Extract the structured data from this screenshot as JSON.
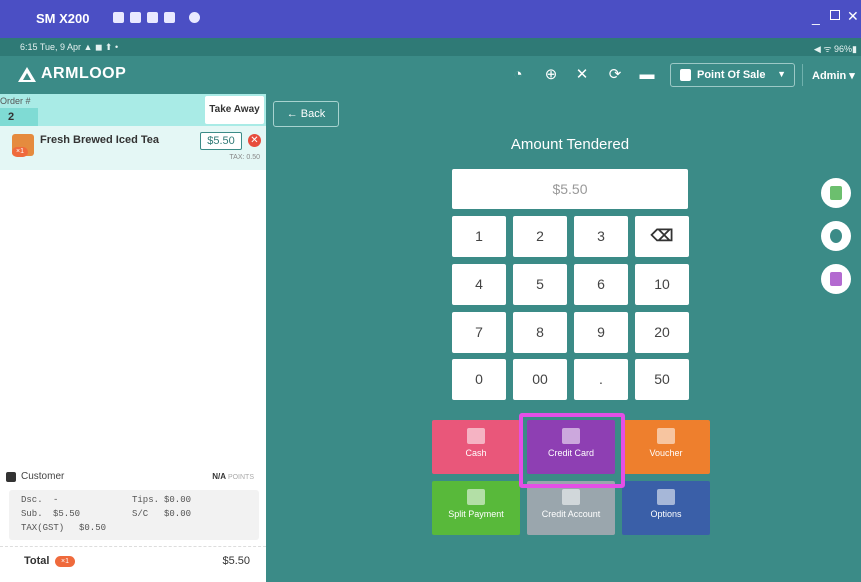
{
  "emulator": {
    "title": "SM X200"
  },
  "status_bar": {
    "time_date": "6:15  Tue, 9 Apr  ▲ ◼ ⬆ •",
    "right": "◀ ᯤ 96%▮"
  },
  "app_bar": {
    "brand": "ARMLOOP",
    "mode": "Point Of Sale",
    "user": "Admin",
    "icons": [
      "speedometer-icon",
      "globe-icon",
      "utensils-icon",
      "sync-icon",
      "printer-icon"
    ]
  },
  "order": {
    "order_label": "Order #",
    "order_number": "2",
    "service_type": "Take Away",
    "items": [
      {
        "name": "Fresh Brewed Iced Tea",
        "qty_badge": "×1",
        "price": "$5.50",
        "tax": "TAX: 0.50"
      }
    ],
    "customer_label": "Customer",
    "customer_value": "N/A",
    "points_label": "POINTS",
    "totals": {
      "dsc_label": "Dsc.",
      "dsc_value": "-",
      "tips_label": "Tips.",
      "tips_value": "$0.00",
      "sub_label": "Sub.",
      "sub_value": "$5.50",
      "sc_label": "S/C",
      "sc_value": "$0.00",
      "tax_label": "TAX(GST)",
      "tax_value": "$0.50"
    },
    "total_label": "Total",
    "total_badge": "×1",
    "total_value": "$5.50"
  },
  "payment": {
    "back_label": "Back",
    "title": "Amount Tendered",
    "amount": "$5.50",
    "keypad": [
      "1",
      "2",
      "3",
      "⌫",
      "4",
      "5",
      "6",
      "10",
      "7",
      "8",
      "9",
      "20",
      "0",
      "00",
      ".",
      "50"
    ],
    "methods": [
      {
        "label": "Cash",
        "color": "#e9577a"
      },
      {
        "label": "Credit Card",
        "color": "#8e3fb3"
      },
      {
        "label": "Voucher",
        "color": "#ee7f2d"
      },
      {
        "label": "Split Payment",
        "color": "#58b93a"
      },
      {
        "label": "Credit Account",
        "color": "#9aa6ad"
      },
      {
        "label": "Options",
        "color": "#3a5fa8"
      }
    ]
  },
  "colors": {
    "teal": "#3b8b87",
    "highlight": "#e44fe6",
    "emulator_bar": "#4b4fc4"
  }
}
